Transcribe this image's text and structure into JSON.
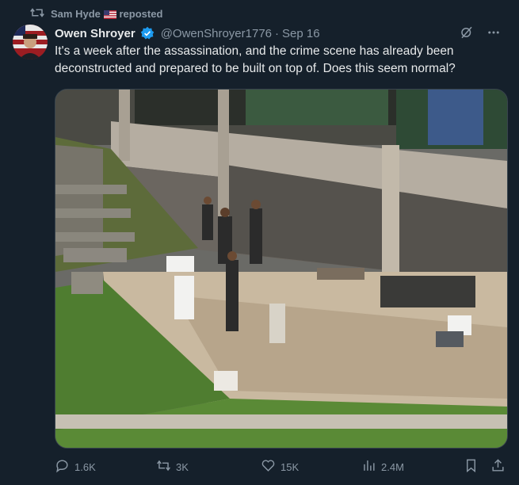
{
  "repost": {
    "icon": "repost-icon",
    "user": "Sam Hyde",
    "flag": "us-flag-icon",
    "label": "reposted"
  },
  "author": {
    "name": "Owen Shroyer",
    "verified_icon": "verified-badge-icon",
    "handle": "@OwenShroyer1776",
    "separator": "·",
    "date": "Sep 16"
  },
  "tweet": {
    "text": "It's a week after the assassination, and the crime scene has already been deconstructed and prepared to be built on top of. Does this seem normal?"
  },
  "actions": {
    "reply_count": "1.6K",
    "repost_count": "3K",
    "like_count": "15K",
    "view_count": "2.4M"
  },
  "colors": {
    "background": "#15202b",
    "text": "#e7e9ea",
    "muted": "#8b98a5",
    "verified": "#1d9bf0"
  }
}
